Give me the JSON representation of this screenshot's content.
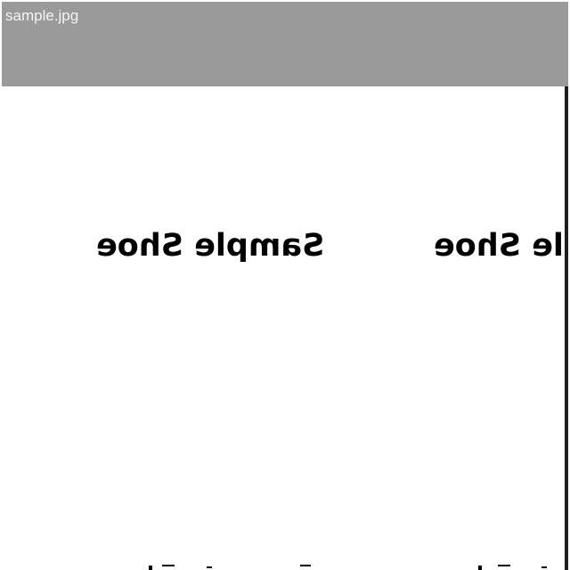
{
  "window": {
    "title": "sample.jpg"
  },
  "image": {
    "labels": [
      "Sample Shoe",
      "Sample Shoe"
    ]
  },
  "colors": {
    "title_bar": "#9a9a9a",
    "title_text": "#f4f4f4",
    "canvas": "#ffffff",
    "edge": "#1e1e1e",
    "text": "#000000"
  }
}
